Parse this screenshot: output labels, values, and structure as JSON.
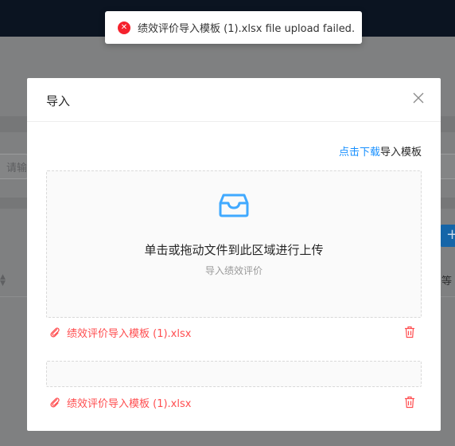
{
  "background": {
    "search_placeholder": "请输",
    "add_button_symbol": "+",
    "column_partial": "等"
  },
  "toast": {
    "message": "绩效评价导入模板 (1).xlsx file upload failed.",
    "icon": "error-circle-icon",
    "color": "#f5222d"
  },
  "modal": {
    "title": "导入",
    "close_icon": "close-icon",
    "download_link": "点击下载",
    "download_suffix": "导入模板",
    "dropzone": {
      "main_text": "单击或拖动文件到此区域进行上传",
      "hint_text": "导入绩效评价",
      "icon": "inbox-icon"
    },
    "files": [
      {
        "name": "绩效评价导入模板 (1).xlsx",
        "status": "error"
      },
      {
        "name": "绩效评价导入模板 (1).xlsx",
        "status": "error"
      }
    ]
  },
  "colors": {
    "primary": "#1890ff",
    "error": "#ff4d4f",
    "topbar": "#0b1421"
  }
}
